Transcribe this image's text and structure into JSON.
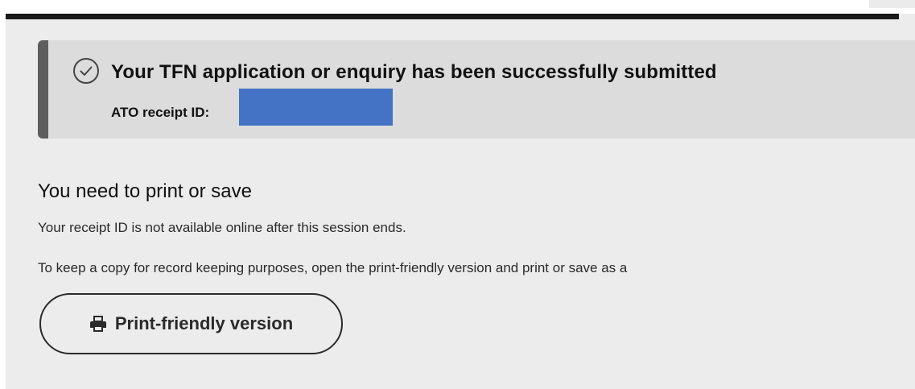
{
  "success_panel": {
    "title": "Your TFN application or enquiry has been successfully submitted",
    "receipt_label": "ATO receipt ID:"
  },
  "notice": {
    "heading": "You need to print or save",
    "line1": "Your receipt ID is not available online after this session ends.",
    "line2": "To keep a copy for record keeping purposes, open the print-friendly version and print or save as a"
  },
  "actions": {
    "print_label": "Print-friendly version"
  },
  "icons": {
    "success": "check-circle-icon",
    "print": "printer-icon"
  },
  "colors": {
    "panel_accent": "#5e5e5e",
    "panel_background": "#dcdcdc",
    "redaction": "#4472c4",
    "page_background": "#ececec"
  }
}
